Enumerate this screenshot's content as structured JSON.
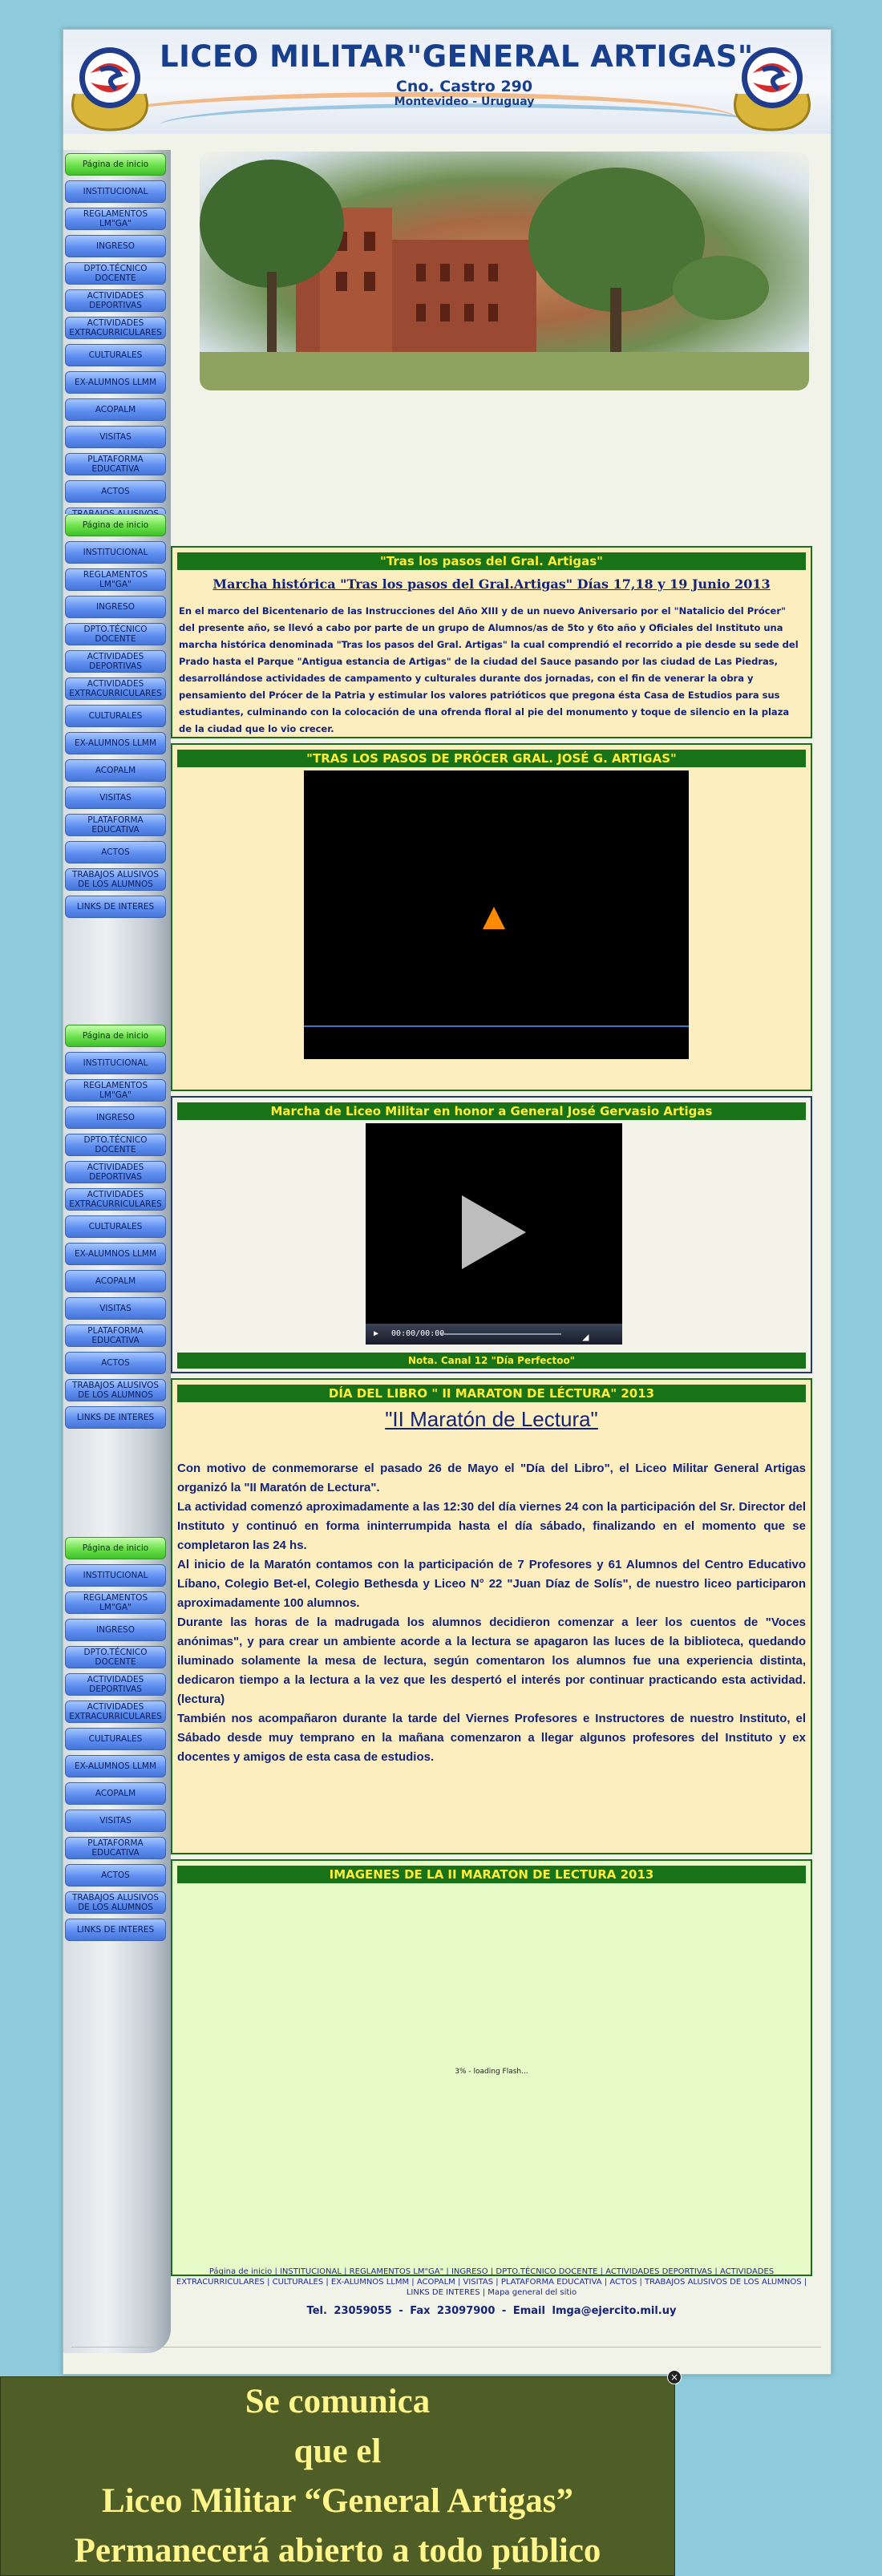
{
  "header": {
    "title": "LICEO MILITAR\"GENERAL ARTIGAS\"",
    "address_line1": "Cno. Castro 290",
    "address_line2": "Montevideo - Uruguay"
  },
  "menu": {
    "home": "Página de inicio",
    "items": [
      "INSTITUCIONAL",
      "REGLAMENTOS LM\"GA\"",
      "INGRESO",
      "DPTO.TÉCNICO DOCENTE",
      "ACTIVIDADES DEPORTIVAS",
      "ACTIVIDADES EXTRACURRICULARES",
      "CULTURALES",
      "EX-ALUMNOS LLMM",
      "ACOPALM",
      "VISITAS",
      "PLATAFORMA EDUCATIVA",
      "ACTOS",
      "TRABAJOS ALUSIVOS DE LOS ALUMNOS",
      "LINKS DE INTERES"
    ]
  },
  "section1": {
    "bar": "\"Tras los pasos del Gral. Artigas\"",
    "subhead": "Marcha histórica \"Tras los pasos del Gral.Artigas\" Días 17,18 y 19 Junio 2013",
    "text": "En el marco del Bicentenario de las Instrucciones del Año XIII y de un nuevo Aniversario por el \"Natalicio del Prócer\" del presente año, se llevó a cabo por parte de un grupo de Alumnos/as de 5to y 6to año y Oficiales del Instituto una marcha histórica denominada \"Tras los pasos del Gral. Artigas\"  la cual comprendió el recorrido a pie desde su sede del Prado hasta el Parque \"Antigua estancia de Artigas\" de la ciudad del Sauce pasando por las ciudad de Las Piedras, desarrollándose actividades de campamento y culturales durante dos jornadas, con el fin de venerar  la obra y pensamiento del Prócer de la Patria y estimular los valores patrióticos que pregona ésta Casa de Estudios para sus estudiantes, culminando con la colocación de una ofrenda floral  al pie del monumento y toque de silencio en la plaza de la ciudad que lo vio crecer."
  },
  "section2": {
    "bar": "\"TRAS LOS PASOS DE PRÓCER GRAL. JOSÉ G. ARTIGAS\""
  },
  "section3": {
    "bar": "Marcha de Liceo Militar en honor a General José Gervasio Artigas",
    "time": "00:00/00:00",
    "note": "Nota. Canal 12 \"Día Perfectoo\""
  },
  "section4": {
    "bar": "DÍA DEL LIBRO \" II MARATON DE LÉCTURA\" 2013",
    "title": "\"II Maratón de Lectura\"",
    "paragraphs": [
      "Con motivo de conmemorarse el pasado 26 de Mayo el \"Día del Libro\", el Liceo Militar General Artigas organizó la \"II Maratón de Lectura\".",
      "La actividad comenzó aproximadamente a las 12:30 del día viernes 24 con la participación del Sr. Director del Instituto y continuó en forma ininterrumpida hasta el día sábado, finalizando en el momento que se completaron las 24 hs.",
      "Al inicio de la Maratón contamos con la participación de 7 Profesores y 61 Alumnos del Centro Educativo Líbano, Colegio Bet-el, Colegio Bethesda y Liceo N° 22 \"Juan Díaz de Solís\", de nuestro liceo participaron aproximadamente 100 alumnos.",
      "Durante las horas de la madrugada los alumnos decidieron comenzar a leer los cuentos de \"Voces anónimas\", y para crear un ambiente acorde a la lectura se apagaron las luces de la biblioteca, quedando iluminado solamente la mesa de lectura, según comentaron los alumnos fue una experiencia distinta, dedicaron tiempo a la lectura a la vez que les despertó el interés por continuar practicando esta actividad. (lectura)",
      "También nos acompañaron durante la tarde del Viernes Profesores e Instructores de nuestro Instituto, el Sábado desde muy temprano en la mañana comenzaron a llegar algunos profesores del Instituto y ex docentes y amigos de esta casa de estudios."
    ]
  },
  "section5": {
    "bar": "IMAGENES DE LA II MARATON DE LECTURA 2013",
    "loading": "3% - loading Flash..."
  },
  "footer": {
    "links": "Página de inicio | INSTITUCIONAL | REGLAMENTOS LM\"GA\" | INGRESO | DPTO.TÉCNICO DOCENTE | ACTIVIDADES DEPORTIVAS | ACTIVIDADES EXTRACURRICULARES | CULTURALES | EX-ALUMNOS LLMM | ACOPALM | VISITAS | PLATAFORMA EDUCATIVA | ACTOS | TRABAJOS ALUSIVOS DE LOS ALUMNOS | LINKS DE INTERES | Mapa general del sitio",
    "contact": "Tel. 23059055   -   Fax 23097900   -   Email  lmga@ejercito.mil.uy"
  },
  "notice": {
    "lines": [
      "Se comunica",
      "que el",
      "Liceo Militar “General Artigas”",
      "Permanecerá abierto a todo público"
    ],
    "close": "×"
  }
}
